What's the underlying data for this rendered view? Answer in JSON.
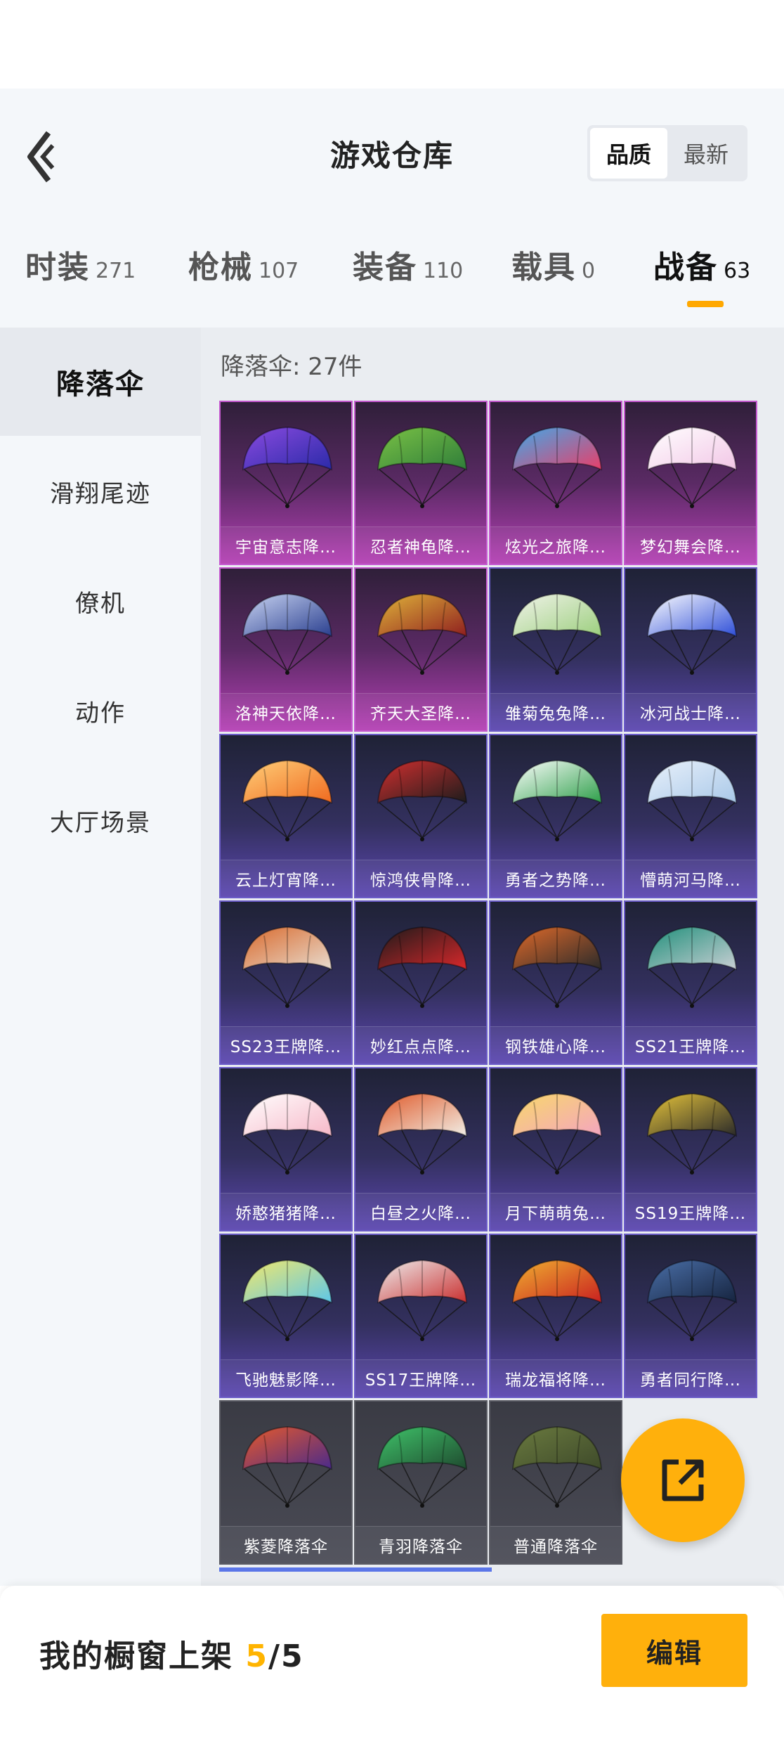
{
  "header": {
    "title": "游戏仓库",
    "sort_options": [
      {
        "label": "品质",
        "active": true
      },
      {
        "label": "最新",
        "active": false
      }
    ]
  },
  "tabs": [
    {
      "label": "时装",
      "count": "271",
      "active": false
    },
    {
      "label": "枪械",
      "count": "107",
      "active": false
    },
    {
      "label": "装备",
      "count": "110",
      "active": false
    },
    {
      "label": "载具",
      "count": "0",
      "active": false
    },
    {
      "label": "战备",
      "count": "63",
      "active": true
    }
  ],
  "sidebar": {
    "items": [
      {
        "label": "降落伞",
        "active": true
      },
      {
        "label": "滑翔尾迹",
        "active": false
      },
      {
        "label": "僚机",
        "active": false
      },
      {
        "label": "动作",
        "active": false
      },
      {
        "label": "大厅场景",
        "active": false
      }
    ]
  },
  "main": {
    "category_label": "降落伞:",
    "category_count": "27件",
    "items": [
      {
        "name": "宇宙意志降…",
        "rarity": "purple",
        "colors": [
          "#2b2aa8",
          "#8a4be0"
        ]
      },
      {
        "name": "忍者神龟降…",
        "rarity": "purple",
        "colors": [
          "#2f7d3a",
          "#7ac245"
        ]
      },
      {
        "name": "炫光之旅降…",
        "rarity": "purple",
        "colors": [
          "#e83f6a",
          "#3fa9e8"
        ]
      },
      {
        "name": "梦幻舞会降…",
        "rarity": "purple",
        "colors": [
          "#f2c6e6",
          "#ffffff"
        ]
      },
      {
        "name": "洛神天依降…",
        "rarity": "purple",
        "colors": [
          "#2a3f8f",
          "#c9d4f2"
        ]
      },
      {
        "name": "齐天大圣降…",
        "rarity": "purple",
        "colors": [
          "#8f1f1f",
          "#e0b43a"
        ]
      },
      {
        "name": "雏菊兔兔降…",
        "rarity": "blue",
        "colors": [
          "#9ccf7e",
          "#f1f3ea"
        ]
      },
      {
        "name": "冰河战士降…",
        "rarity": "blue",
        "colors": [
          "#2f4fd8",
          "#ffffff"
        ]
      },
      {
        "name": "云上灯宵降…",
        "rarity": "blue",
        "colors": [
          "#f06a1f",
          "#ffd07a"
        ]
      },
      {
        "name": "惊鸿侠骨降…",
        "rarity": "blue",
        "colors": [
          "#1c1c1c",
          "#d22f2f"
        ]
      },
      {
        "name": "勇者之势降…",
        "rarity": "blue",
        "colors": [
          "#2e9f4a",
          "#ffffff"
        ]
      },
      {
        "name": "懵萌河马降…",
        "rarity": "blue",
        "colors": [
          "#a9c8e8",
          "#e9f1fb"
        ]
      },
      {
        "name": "SS23王牌降…",
        "rarity": "blue",
        "colors": [
          "#e8dccf",
          "#d9692c"
        ]
      },
      {
        "name": "妙红点点降…",
        "rarity": "blue",
        "colors": [
          "#d8282b",
          "#1a1a1a"
        ]
      },
      {
        "name": "钢铁雄心降…",
        "rarity": "blue",
        "colors": [
          "#2a2a2a",
          "#e06a2a"
        ]
      },
      {
        "name": "SS21王牌降…",
        "rarity": "blue",
        "colors": [
          "#c9cfd4",
          "#1f8f7a"
        ]
      },
      {
        "name": "娇憨猪猪降…",
        "rarity": "blue",
        "colors": [
          "#f6b8c8",
          "#ffffff"
        ]
      },
      {
        "name": "白昼之火降…",
        "rarity": "blue",
        "colors": [
          "#f1eee6",
          "#e05a2a"
        ]
      },
      {
        "name": "月下萌萌兔…",
        "rarity": "blue",
        "colors": [
          "#f4a5c0",
          "#f8d86a"
        ]
      },
      {
        "name": "SS19王牌降…",
        "rarity": "blue",
        "colors": [
          "#2a2a2a",
          "#e6c43a"
        ]
      },
      {
        "name": "飞驰魅影降…",
        "rarity": "blue",
        "colors": [
          "#5ec7e8",
          "#f4e86a"
        ]
      },
      {
        "name": "SS17王牌降…",
        "rarity": "blue",
        "colors": [
          "#c92f2f",
          "#eeeeee"
        ]
      },
      {
        "name": "瑞龙福将降…",
        "rarity": "blue",
        "colors": [
          "#c92020",
          "#f0b030"
        ]
      },
      {
        "name": "勇者同行降…",
        "rarity": "blue",
        "colors": [
          "#16243f",
          "#4a6fa8"
        ]
      },
      {
        "name": "紫菱降落伞",
        "rarity": "gray",
        "colors": [
          "#4a2a8a",
          "#e85a2a"
        ]
      },
      {
        "name": "青羽降落伞",
        "rarity": "gray",
        "colors": [
          "#1f4a2f",
          "#3fc46a"
        ]
      },
      {
        "name": "普通降落伞",
        "rarity": "gray",
        "colors": [
          "#3e4a2a",
          "#6a7a3f"
        ]
      }
    ]
  },
  "footer": {
    "label": "我的橱窗上架",
    "current": "5",
    "total": "/5",
    "edit_label": "编辑"
  },
  "icons": {
    "back": "chevron-left-icon",
    "share": "external-link-icon"
  }
}
